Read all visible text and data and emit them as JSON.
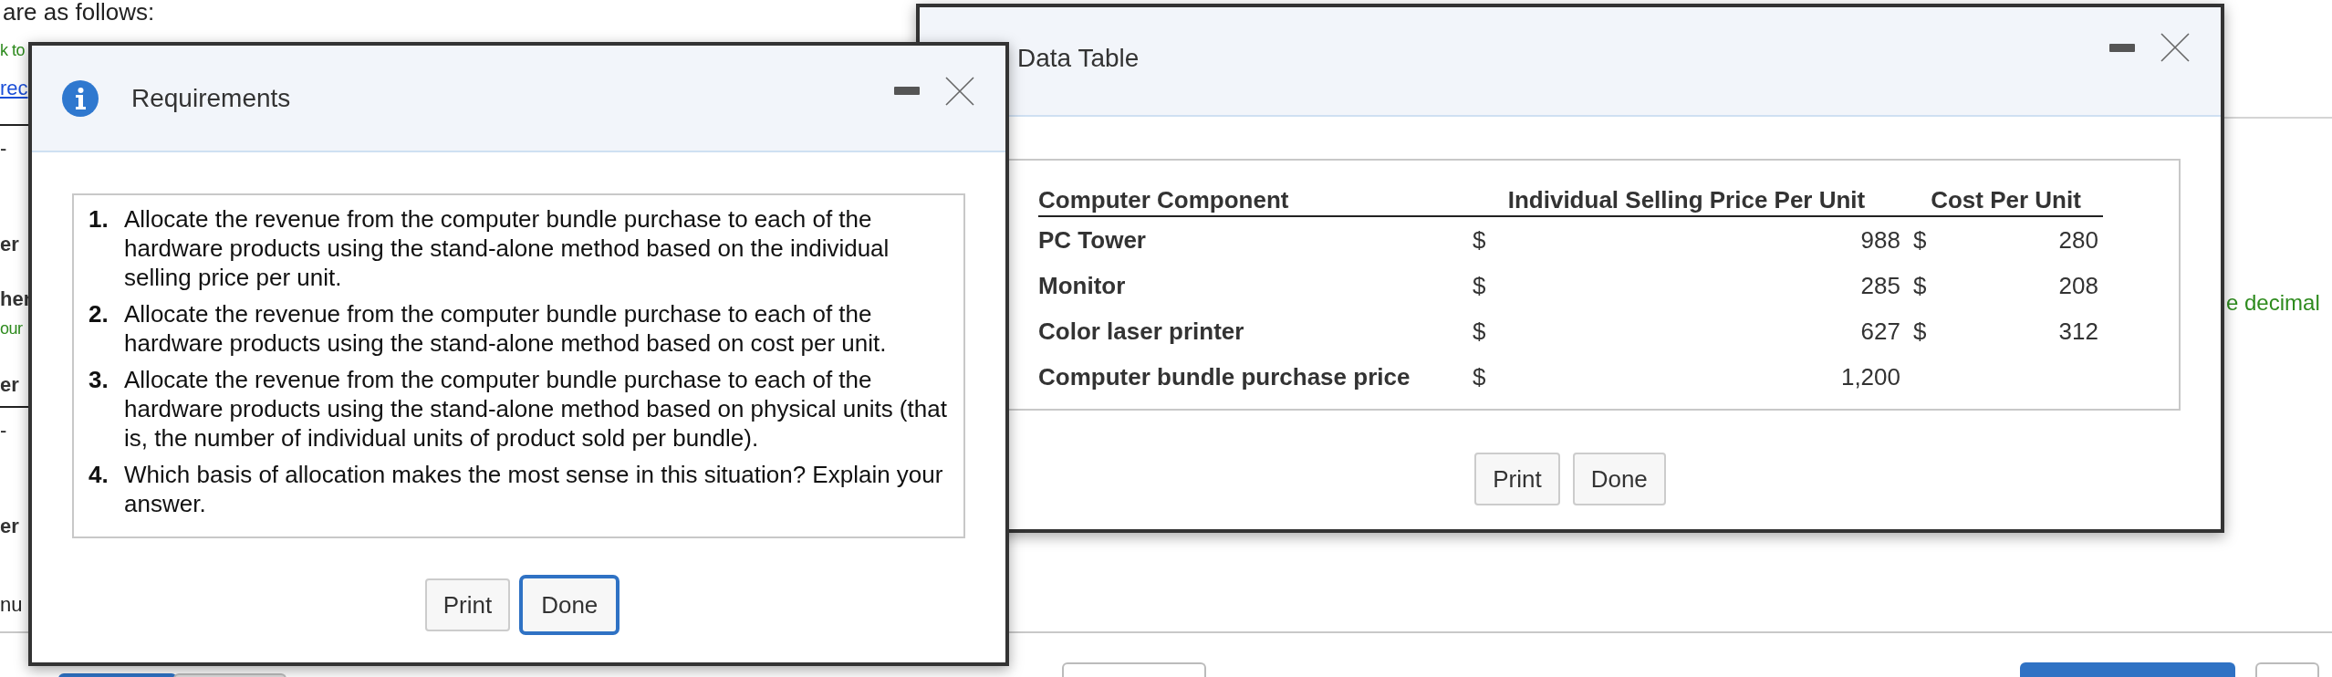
{
  "page": {
    "intro": "are as follows:",
    "fragments": [
      {
        "text": "k to",
        "kind": "green"
      },
      {
        "text": "rec",
        "kind": "link"
      },
      {
        "text": "-",
        "kind": "plain"
      },
      {
        "text": "er",
        "kind": "bold"
      },
      {
        "text": "her",
        "kind": "bold"
      },
      {
        "text": "our",
        "kind": "green"
      },
      {
        "text": "er",
        "kind": "bold"
      },
      {
        "text": "-",
        "kind": "plain"
      },
      {
        "text": "er",
        "kind": "bold"
      },
      {
        "text": "nu",
        "kind": "plain"
      }
    ],
    "right_note": "e decimal"
  },
  "requirements_dialog": {
    "title": "Requirements",
    "items": [
      {
        "number": "1.",
        "text": "Allocate the revenue from the computer bundle purchase to each of the hardware products using the stand-alone method based on the individual selling price per unit."
      },
      {
        "number": "2.",
        "text": "Allocate the revenue from the computer bundle purchase to each of the hardware products using the stand-alone method based on cost per unit."
      },
      {
        "number": "3.",
        "text": "Allocate the revenue from the computer bundle purchase to each of the hardware products using the stand-alone method based on physical units (that is, the number of individual units of product sold per bundle)."
      },
      {
        "number": "4.",
        "text": "Which basis of allocation makes the most sense in this situation? Explain your answer."
      }
    ],
    "buttons": [
      {
        "label": "Print",
        "selected": false
      },
      {
        "label": "Done",
        "selected": true
      }
    ]
  },
  "data_table_dialog": {
    "title": "Data Table",
    "columns": [
      "Computer Component",
      "Individual Selling Price Per Unit",
      "Cost Per Unit"
    ],
    "rows": [
      {
        "component": "PC Tower",
        "price_symbol": "$",
        "price": "988",
        "cost_symbol": "$",
        "cost": "280"
      },
      {
        "component": "Monitor",
        "price_symbol": "$",
        "price": "285",
        "cost_symbol": "$",
        "cost": "208"
      },
      {
        "component": "Color laser printer",
        "price_symbol": "$",
        "price": "627",
        "cost_symbol": "$",
        "cost": "312"
      },
      {
        "component": "Computer bundle purchase price",
        "price_symbol": "$",
        "price": "1,200"
      }
    ],
    "buttons": [
      {
        "label": "Print",
        "selected": false
      },
      {
        "label": "Done",
        "selected": false
      }
    ]
  }
}
